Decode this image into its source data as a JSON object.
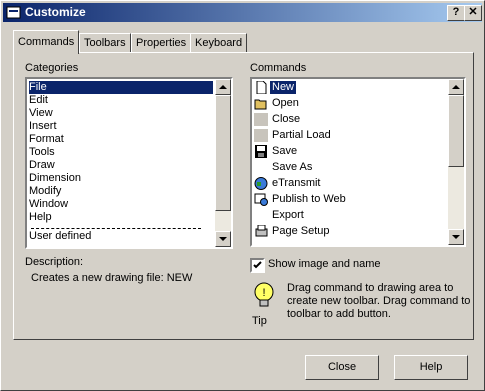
{
  "window": {
    "title": "Customize",
    "help_btn": "?",
    "close_btn": "✕"
  },
  "tabs": [
    {
      "label": "Commands",
      "active": true
    },
    {
      "label": "Toolbars"
    },
    {
      "label": "Properties"
    },
    {
      "label": "Keyboard"
    }
  ],
  "categories": {
    "label": "Categories",
    "items": [
      "File",
      "Edit",
      "View",
      "Insert",
      "Format",
      "Tools",
      "Draw",
      "Dimension",
      "Modify",
      "Window",
      "Help",
      "User defined"
    ],
    "selected": "File"
  },
  "commands": {
    "label": "Commands",
    "items": [
      {
        "label": "New",
        "icon": "new-document-icon",
        "selected": true
      },
      {
        "label": "Open",
        "icon": "open-folder-icon"
      },
      {
        "label": "Close",
        "icon": "blank-icon"
      },
      {
        "label": "Partial Load",
        "icon": "blank-icon"
      },
      {
        "label": "Save",
        "icon": "floppy-disk-icon"
      },
      {
        "label": "Save As",
        "icon": "none"
      },
      {
        "label": "eTransmit",
        "icon": "etransmit-icon"
      },
      {
        "label": "Publish to Web",
        "icon": "publish-web-icon"
      },
      {
        "label": "Export",
        "icon": "none"
      },
      {
        "label": "Page Setup",
        "icon": "page-setup-icon"
      }
    ]
  },
  "description": {
    "label": "Description:",
    "text": "Creates a new drawing file:  NEW"
  },
  "show_image_and_name": {
    "label": "Show image and name",
    "checked": true
  },
  "tip": {
    "label": "Tip",
    "text": "Drag command to drawing area to create new toolbar. Drag command to toolbar to add button."
  },
  "buttons": {
    "close": "Close",
    "help": "Help"
  }
}
